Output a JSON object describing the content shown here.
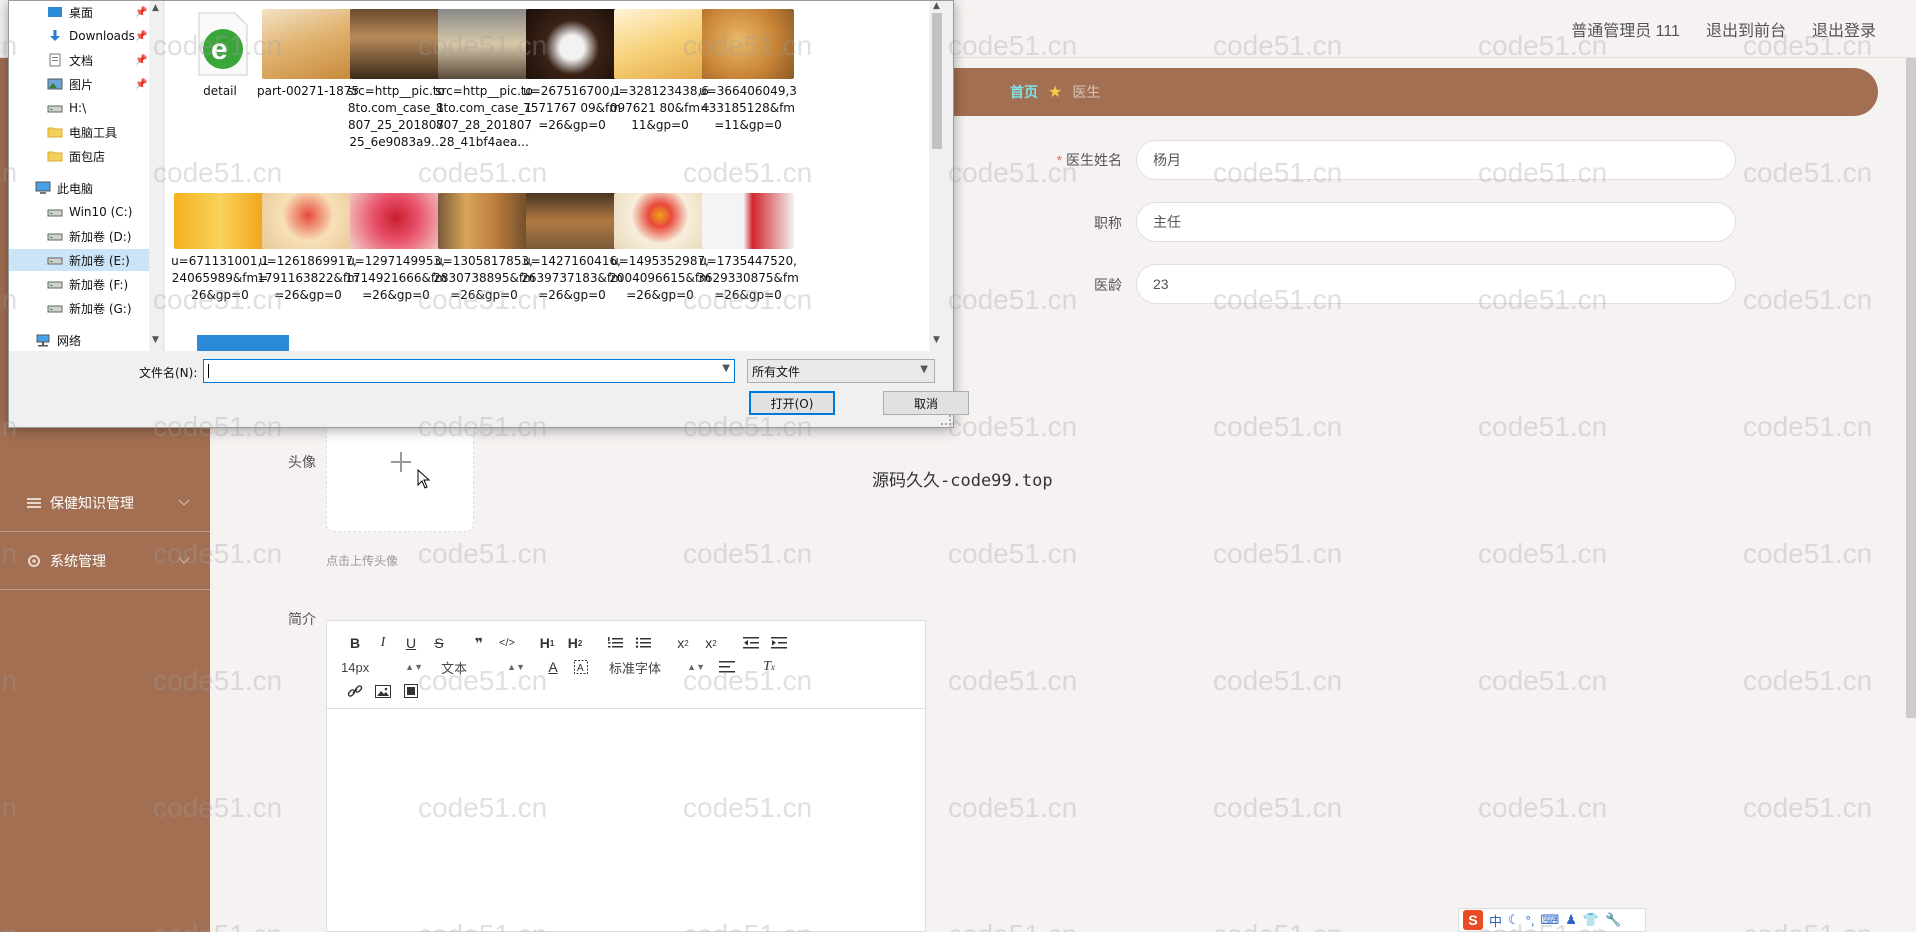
{
  "header": {
    "user_label": "普通管理员 111",
    "back_to_front": "退出到前台",
    "logout": "退出登录"
  },
  "sidebar": {
    "items": [
      {
        "label": "保健知识管理",
        "icon": "list-icon"
      },
      {
        "label": "系统管理",
        "icon": "gear-icon"
      }
    ]
  },
  "breadcrumb": {
    "home": "首页",
    "current": "医生"
  },
  "form": {
    "name_label": "医生姓名",
    "required_mark": "*",
    "name_value": "杨月",
    "title_label": "职称",
    "title_value": "主任",
    "age_label": "医龄",
    "age_value": "23",
    "avatar_label": "头像",
    "avatar_tip": "点击上传头像",
    "intro_label": "简介"
  },
  "editor": {
    "font_size": "14px",
    "header_picker": "文本",
    "font_family": "标准字体",
    "toolbar_buttons": [
      "B",
      "I",
      "U",
      "S",
      "❞",
      "</>",
      "H1",
      "H2",
      "ol",
      "ul",
      "x₂",
      "x²",
      "outdent",
      "indent",
      "A",
      "bg",
      "align",
      "Tx",
      "link",
      "image",
      "video"
    ]
  },
  "center_note": "源码久久-code99.top",
  "watermark_text": "code51.cn",
  "file_dialog": {
    "tree": [
      {
        "label": "桌面",
        "icon": "desktop-icon",
        "pinned": true
      },
      {
        "label": "Downloads",
        "icon": "download-icon",
        "pinned": true
      },
      {
        "label": "文档",
        "icon": "document-icon",
        "pinned": true
      },
      {
        "label": "图片",
        "icon": "picture-icon",
        "pinned": true
      },
      {
        "label": "H:\\",
        "icon": "drive-icon",
        "pinned": false
      },
      {
        "label": "电脑工具",
        "icon": "folder-icon",
        "pinned": false
      },
      {
        "label": "面包店",
        "icon": "folder-icon",
        "pinned": false
      },
      {
        "label": "此电脑",
        "icon": "computer-icon",
        "pinned": false
      },
      {
        "label": "Win10 (C:)",
        "icon": "drive-icon",
        "pinned": false
      },
      {
        "label": "新加卷 (D:)",
        "icon": "drive-icon",
        "pinned": false
      },
      {
        "label": "新加卷 (E:)",
        "icon": "drive-icon",
        "pinned": false,
        "selected": true
      },
      {
        "label": "新加卷 (F:)",
        "icon": "drive-icon",
        "pinned": false
      },
      {
        "label": "新加卷 (G:)",
        "icon": "drive-icon",
        "pinned": false
      },
      {
        "label": "网络",
        "icon": "network-icon",
        "pinned": false
      }
    ],
    "files": [
      {
        "name": "detail",
        "thumb": "ie-html-icon"
      },
      {
        "name": "part-00271-1875",
        "thumb": "bread-loaf"
      },
      {
        "name": "src=http__pic.to8to.com_case_1807_25_20180725_6e9083a9...",
        "thumb": "bakery-shop"
      },
      {
        "name": "src=http__pic.to8to.com_case_1807_28_20180728_41bf4aea...",
        "thumb": "bakery-counter"
      },
      {
        "name": "u=267516700,17571767 09&fm=26&gp=0",
        "thumb": "chocolate-cake"
      },
      {
        "name": "u=328123438,6097621 80&fm=11&gp=0",
        "thumb": "sponge-cake"
      },
      {
        "name": "u=366406049,3433185128&fm=11&gp=0",
        "thumb": "buns"
      },
      {
        "name": "u=671131001,124065989&fm=26&gp=0",
        "thumb": "orange-banner"
      },
      {
        "name": "u=1261869917,1791163822&fm=26&gp=0",
        "thumb": "fruit-cake"
      },
      {
        "name": "u=1297149953,1714921666&fm=26&gp=0",
        "thumb": "berry-cake"
      },
      {
        "name": "u=1305817853,2830738895&fm=26&gp=0",
        "thumb": "baguettes"
      },
      {
        "name": "u=1427160416,2639737183&fm=26&gp=0",
        "thumb": "bread-rolls"
      },
      {
        "name": "u=1495352987,2004096615&fm=26&gp=0",
        "thumb": "fruit-cream-cake"
      },
      {
        "name": "u=1735447520,3629330875&fm=26&gp=0",
        "thumb": "milk-cartons"
      }
    ],
    "filename_label": "文件名(N):",
    "filename_value": "",
    "filetype": "所有文件",
    "open_button": "打开(O)",
    "cancel_button": "取消"
  },
  "tray": {
    "ime": "中"
  }
}
